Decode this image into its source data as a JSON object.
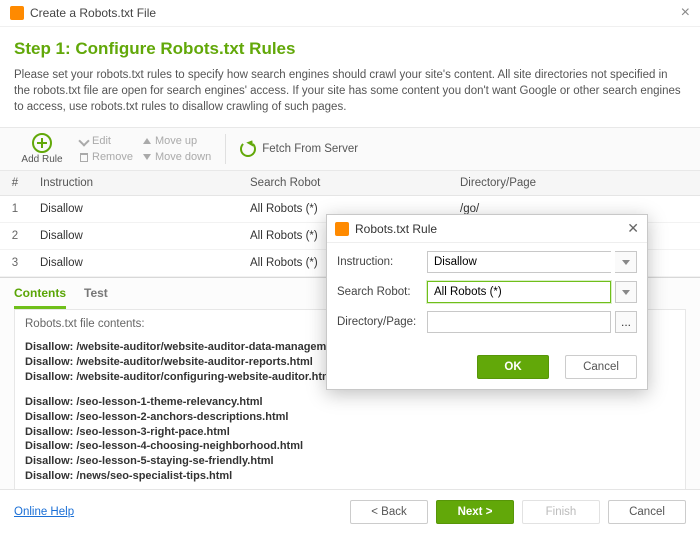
{
  "window": {
    "title": "Create a Robots.txt File"
  },
  "step": {
    "title": "Step 1: Configure Robots.txt Rules",
    "intro": "Please set your robots.txt rules to specify how search engines should crawl your site's content. All site directories not specified in the robots.txt file are open for search engines' access. If your site has some content you don't want Google or other search engines to access, use robots.txt rules to disallow crawling of such pages."
  },
  "toolbar": {
    "add": "Add Rule",
    "edit": "Edit",
    "remove": "Remove",
    "moveup": "Move up",
    "movedown": "Move down",
    "fetch": "Fetch From Server"
  },
  "table": {
    "headers": {
      "num": "#",
      "instruction": "Instruction",
      "robot": "Search Robot",
      "dir": "Directory/Page"
    },
    "rows": [
      {
        "num": "1",
        "instruction": "Disallow",
        "robot": "All Robots (*)",
        "dir": "/go/"
      },
      {
        "num": "2",
        "instruction": "Disallow",
        "robot": "All Robots (*)",
        "dir": ""
      },
      {
        "num": "3",
        "instruction": "Disallow",
        "robot": "All Robots (*)",
        "dir": ""
      }
    ]
  },
  "tabs": {
    "contents": "Contents",
    "test": "Test"
  },
  "file": {
    "label": "Robots.txt file contents:",
    "lines": [
      "Disallow: /website-auditor/website-auditor-data-management.html",
      "Disallow: /website-auditor/website-auditor-reports.html",
      "Disallow: /website-auditor/configuring-website-auditor.html",
      "",
      "Disallow: /seo-lesson-1-theme-relevancy.html",
      "Disallow: /seo-lesson-2-anchors-descriptions.html",
      "Disallow: /seo-lesson-3-right-pace.html",
      "Disallow: /seo-lesson-4-choosing-neighborhood.html",
      "Disallow: /seo-lesson-5-staying-se-friendly.html",
      "Disallow: /news/seo-specialist-tips.html"
    ]
  },
  "footer": {
    "help": "Online Help",
    "back": "< Back",
    "next": "Next >",
    "finish": "Finish",
    "cancel": "Cancel"
  },
  "dialog": {
    "title": "Robots.txt Rule",
    "labels": {
      "instruction": "Instruction:",
      "robot": "Search Robot:",
      "dir": "Directory/Page:"
    },
    "values": {
      "instruction": "Disallow",
      "robot": "All Robots (*)",
      "dir": ""
    },
    "browse": "...",
    "ok": "OK",
    "cancel": "Cancel"
  }
}
